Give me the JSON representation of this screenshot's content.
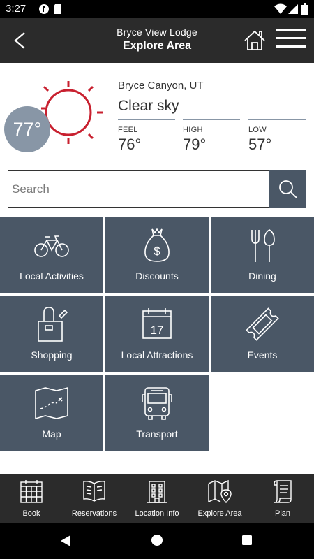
{
  "status_bar": {
    "time": "3:27"
  },
  "header": {
    "subtitle": "Bryce View Lodge",
    "title": "Explore Area"
  },
  "weather": {
    "temperature": "77°",
    "location": "Bryce Canyon, UT",
    "condition": "Clear sky",
    "stats": [
      {
        "label": "FEEL",
        "value": "76°"
      },
      {
        "label": "HIGH",
        "value": "79°"
      },
      {
        "label": "LOW",
        "value": "57°"
      }
    ],
    "sun_color": "#c8202f",
    "badge_color": "#8896a6"
  },
  "search": {
    "placeholder": "Search",
    "value": ""
  },
  "tiles": [
    {
      "label": "Local Activities",
      "icon": "bicycle-icon"
    },
    {
      "label": "Discounts",
      "icon": "money-bag-icon"
    },
    {
      "label": "Dining",
      "icon": "fork-knife-icon"
    },
    {
      "label": "Shopping",
      "icon": "shopping-bag-icon"
    },
    {
      "label": "Local Attractions",
      "icon": "calendar-icon",
      "calendar_day": "17"
    },
    {
      "label": "Events",
      "icon": "ticket-icon"
    },
    {
      "label": "Map",
      "icon": "map-icon"
    },
    {
      "label": "Transport",
      "icon": "bus-icon"
    }
  ],
  "bottom_nav": [
    {
      "label": "Book",
      "icon": "calendar-grid-icon"
    },
    {
      "label": "Reservations",
      "icon": "book-icon"
    },
    {
      "label": "Location Info",
      "icon": "building-icon"
    },
    {
      "label": "Explore Area",
      "icon": "map-pin-icon"
    },
    {
      "label": "Plan",
      "icon": "scroll-icon"
    }
  ],
  "colors": {
    "header_bg": "#2b2b2b",
    "tile_bg": "#4a5766"
  }
}
